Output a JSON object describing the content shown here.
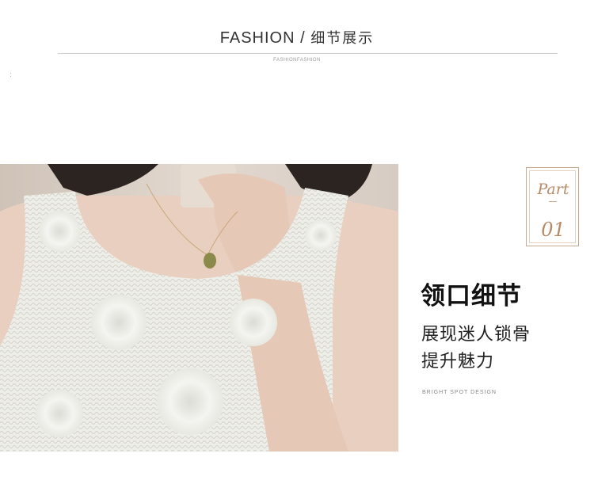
{
  "header": {
    "title_en": "FASHION",
    "separator": " / ",
    "title_cn": "细节展示",
    "subtitle": "FASHIONFASHION"
  },
  "part": {
    "word": "Part",
    "number": "01"
  },
  "feature": {
    "heading": "领口细节",
    "line1": "展现迷人锁骨",
    "line2": "提升魅力",
    "caption": "BRIGHT SPOT DESIGN"
  },
  "colors": {
    "accent": "#b88a66",
    "text": "#222222"
  }
}
